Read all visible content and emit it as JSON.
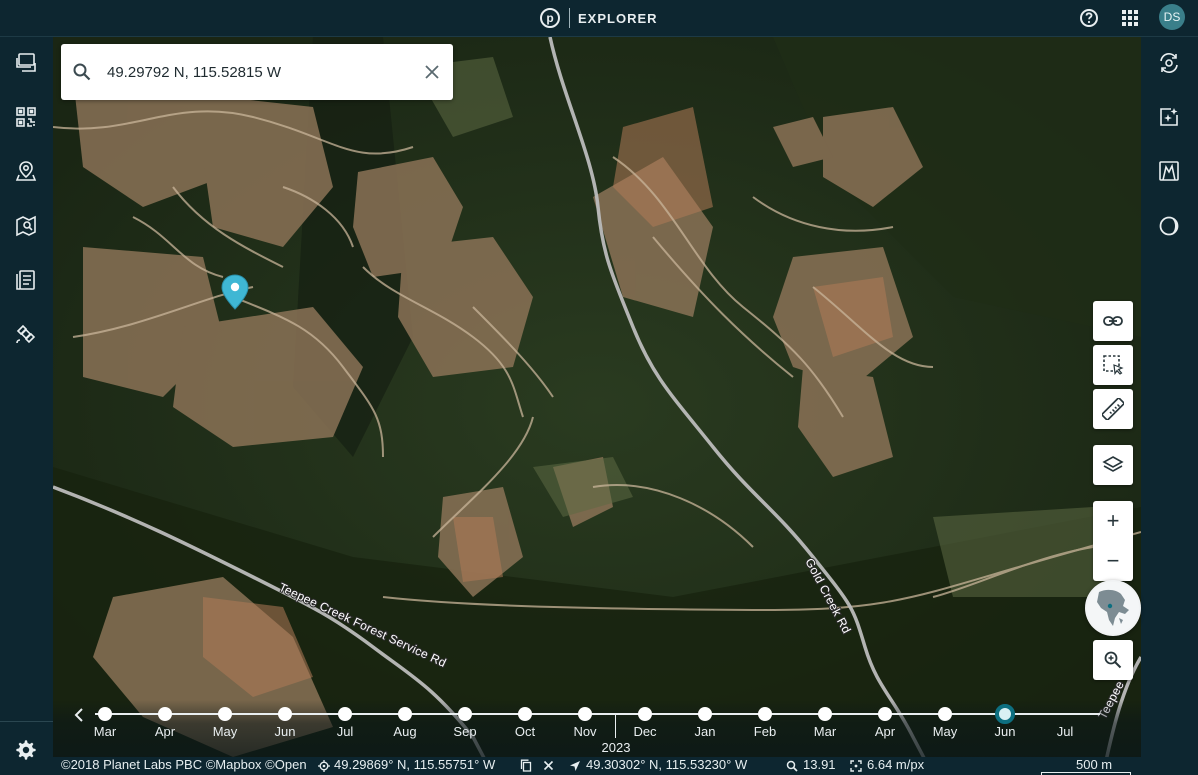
{
  "app": {
    "name": "EXPLORER",
    "logo_letter": "p"
  },
  "header": {
    "help_icon": "help-circle-icon",
    "apps_icon": "apps-grid-icon",
    "user_initials": "DS"
  },
  "left_rail": {
    "items": [
      {
        "icon": "layers-stack-icon"
      },
      {
        "icon": "qr-grid-icon"
      },
      {
        "icon": "map-pin-icon"
      },
      {
        "icon": "map-search-icon"
      },
      {
        "icon": "document-list-icon"
      },
      {
        "icon": "satellite-icon"
      }
    ],
    "settings_icon": "settings-gear-icon"
  },
  "right_rail": {
    "items": [
      {
        "icon": "sync-sun-icon"
      },
      {
        "icon": "ai-image-icon"
      },
      {
        "icon": "terrain-3d-icon"
      },
      {
        "icon": "day-night-icon"
      }
    ]
  },
  "search": {
    "value": "49.29792 N, 115.52815 W",
    "placeholder": "Search"
  },
  "map": {
    "road_labels": [
      "Teepee Creek Forest Service Rd",
      "Gold Creek Rd",
      "Teepee C"
    ],
    "controls": {
      "link_icon": "link-icon",
      "select_area_icon": "select-area-icon",
      "measure_icon": "ruler-icon",
      "layers_icon": "layers-icon",
      "zoom_in": "+",
      "zoom_out": "−",
      "globe_icon": "globe-icon",
      "zoom_area_icon": "zoom-area-icon"
    },
    "pin_color": "#3fb7d4"
  },
  "timeline": {
    "months": [
      "Mar",
      "Apr",
      "May",
      "Jun",
      "Jul",
      "Aug",
      "Sep",
      "Oct",
      "Nov",
      "Dec",
      "Jan",
      "Feb",
      "Mar",
      "Apr",
      "May",
      "Jun",
      "Jul"
    ],
    "selected_index": 15,
    "year": "2023",
    "accent": "#0d6f80"
  },
  "status": {
    "attribution": "©2018 Planet Labs PBC ©Mapbox ©Open",
    "center_coords": "49.29869° N, 115.55751° W",
    "cursor_coords": "49.30302° N, 115.53230° W",
    "zoom": "13.91",
    "resolution": "6.64 m/px",
    "scale": "500 m"
  },
  "colors": {
    "chrome": "#0d2630",
    "accent": "#0d6f80"
  }
}
